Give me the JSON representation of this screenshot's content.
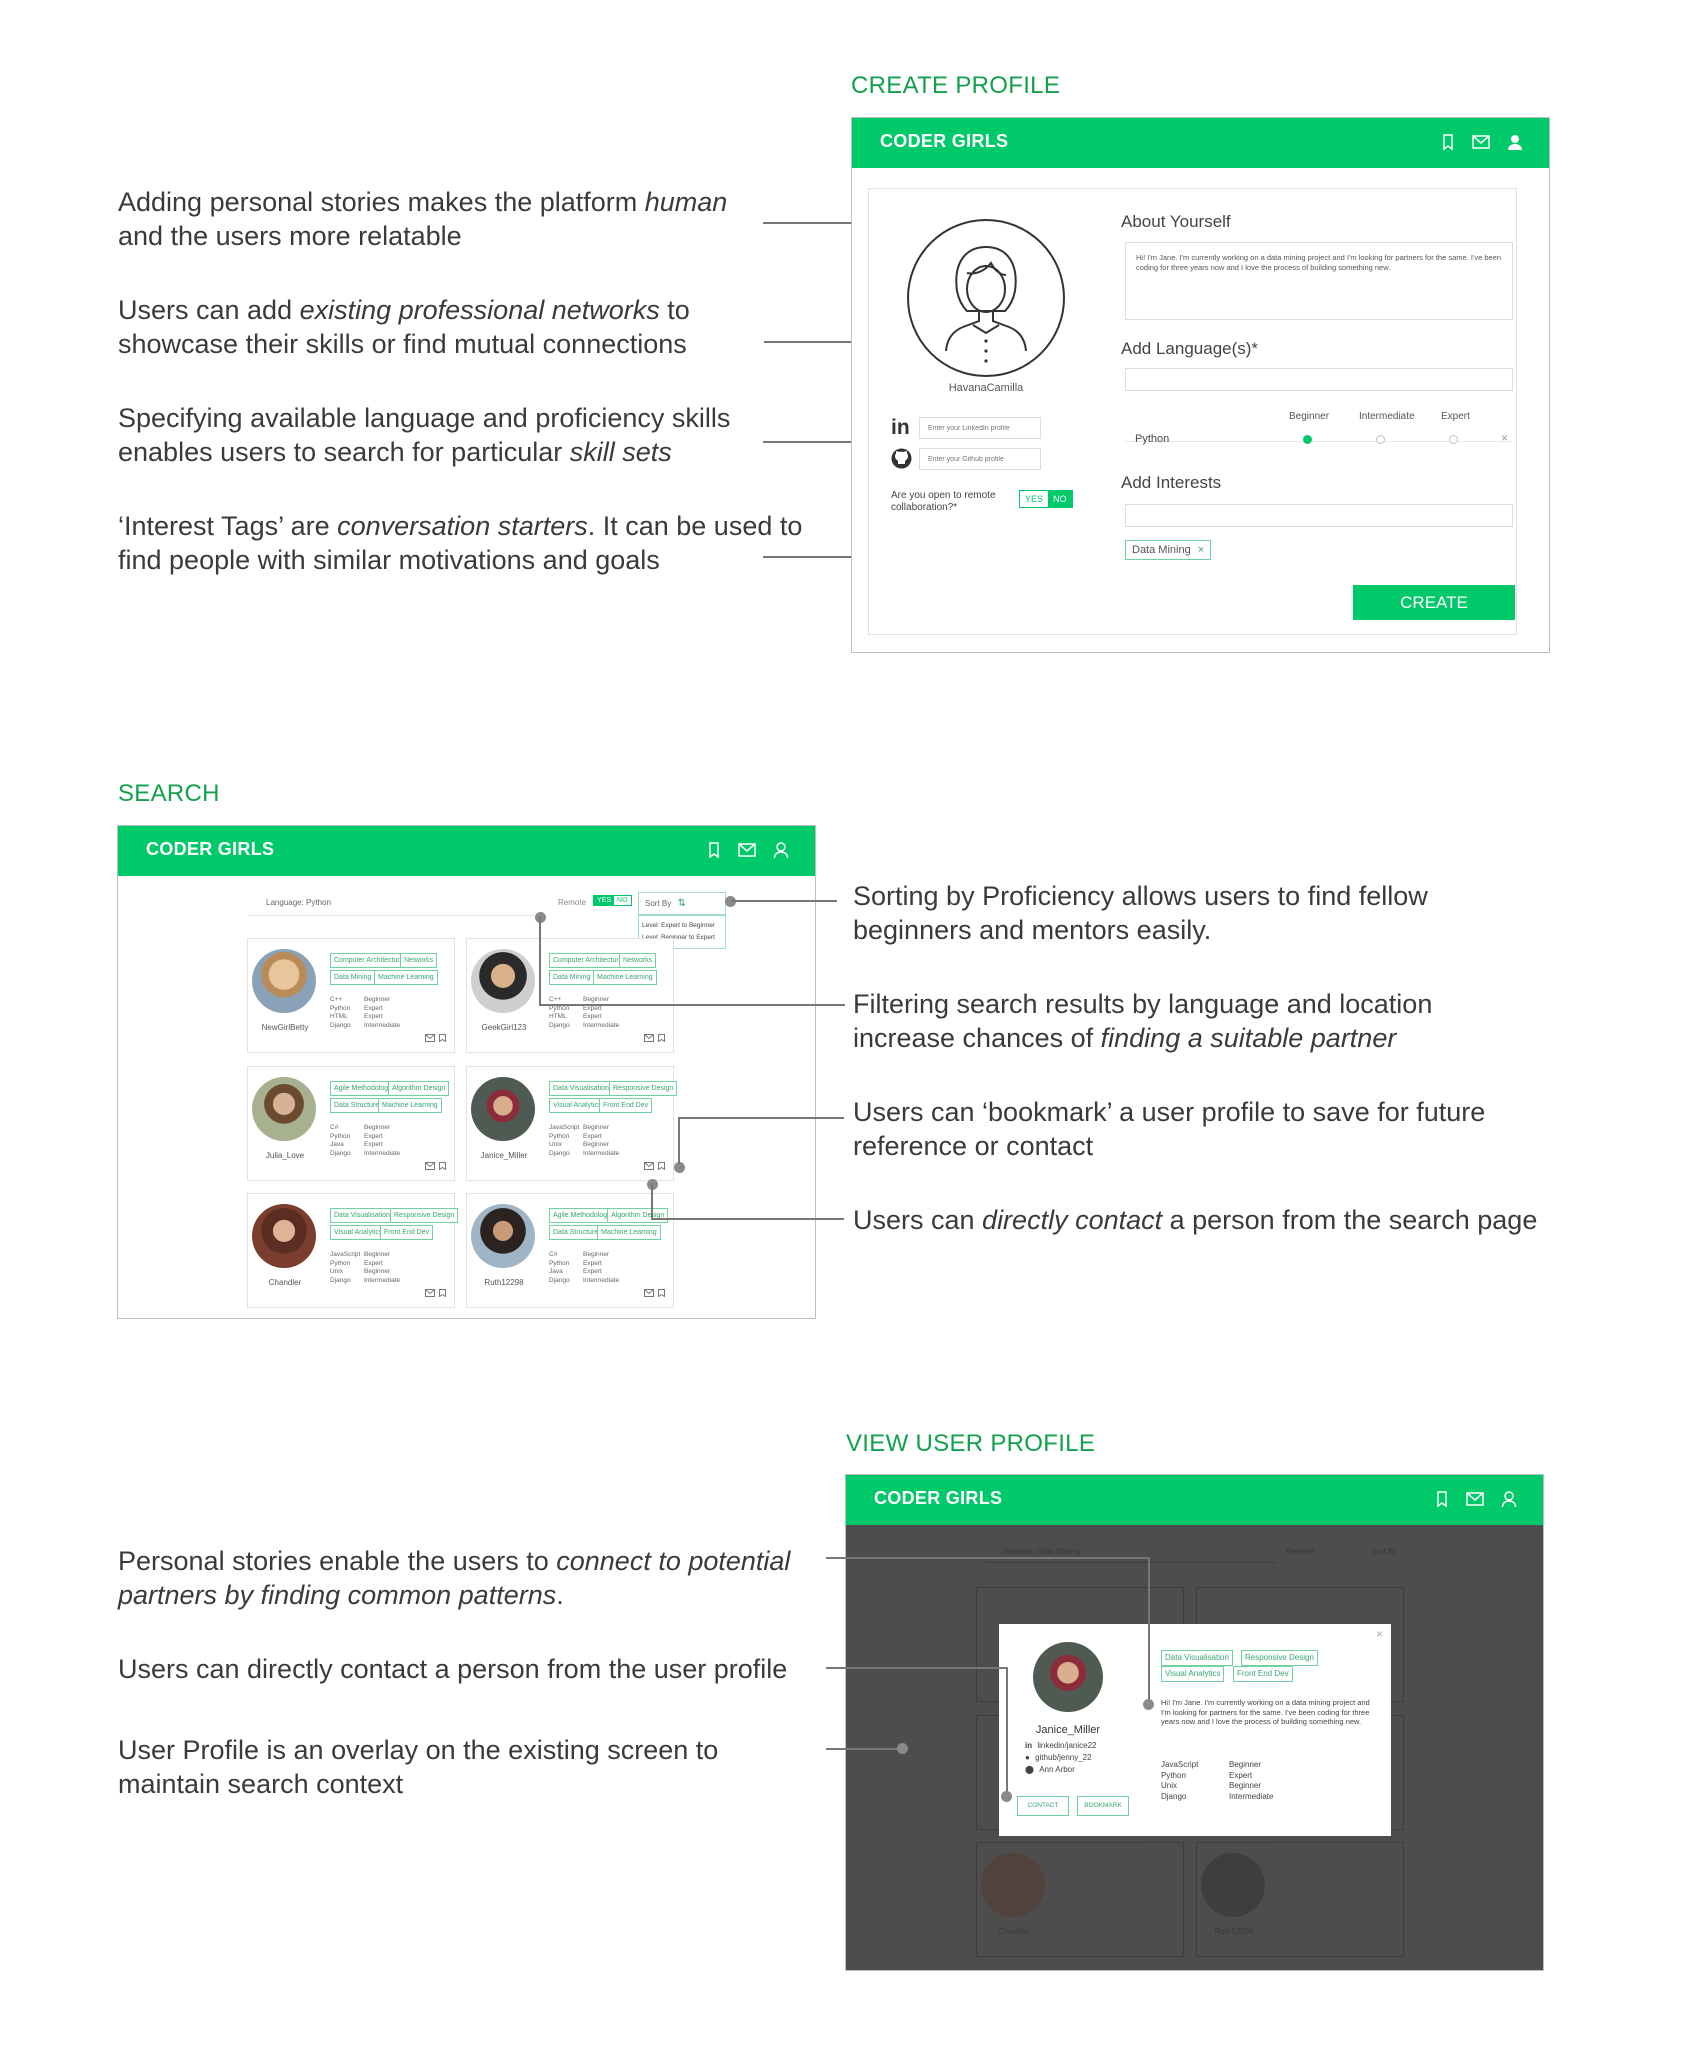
{
  "sections": {
    "create_title": "CREATE PROFILE",
    "search_title": "SEARCH",
    "view_title": "VIEW USER PROFILE"
  },
  "brand": "CODER GIRLS",
  "create": {
    "username": "HavanaCamilla",
    "about_label": "About Yourself",
    "about_text": "Hi! I'm Jane. I'm currently working on a data mining project and I'm looking for partners for the same. I've been coding for three years now and I love the process of building something new.",
    "language_label": "Add Language(s)*",
    "levels": [
      "Beginner",
      "Intermediate",
      "Expert"
    ],
    "language_row": "Python",
    "linkedin_placeholder": "Enter your LinkedIn profile",
    "github_placeholder": "Enter your Github profile",
    "remote_question": "Are you open to remote collaboration?*",
    "yes": "YES",
    "no": "NO",
    "interests_label": "Add Interests",
    "interest_tag": "Data Mining",
    "create_button": "CREATE"
  },
  "search": {
    "query": "Language: Python",
    "remote_label": "Remote",
    "sort_label": "Sort By",
    "sort_options": [
      "Level: Expert to Beginner",
      "Level: Beginner to Expert"
    ],
    "cards": [
      {
        "name": "NewGirlBetty",
        "tags": [
          "Computer Architecture",
          "Networks",
          "Data Mining",
          "Machine Learning"
        ],
        "skills": [
          [
            "C++",
            "Beginner"
          ],
          [
            "Python",
            "Expert"
          ],
          [
            "HTML",
            "Expert"
          ],
          [
            "Django",
            "Intermediate"
          ]
        ]
      },
      {
        "name": "GeekGirl123",
        "tags": [
          "Computer Architecture",
          "Networks",
          "Data Mining",
          "Machine Learning"
        ],
        "skills": [
          [
            "C++",
            "Beginner"
          ],
          [
            "Python",
            "Expert"
          ],
          [
            "HTML",
            "Expert"
          ],
          [
            "Django",
            "Intermediate"
          ]
        ]
      },
      {
        "name": "Julia_Love",
        "tags": [
          "Agile Methodology",
          "Algorithm Design",
          "Data Structure",
          "Machine Learning"
        ],
        "skills": [
          [
            "C#",
            "Beginner"
          ],
          [
            "Python",
            "Expert"
          ],
          [
            "Java",
            "Expert"
          ],
          [
            "Django",
            "Intermediate"
          ]
        ]
      },
      {
        "name": "Janice_Miller",
        "tags": [
          "Data Visualisation",
          "Responsive Design",
          "Visual Analytics",
          "Front End Dev"
        ],
        "skills": [
          [
            "JavaScript",
            "Beginner"
          ],
          [
            "Python",
            "Expert"
          ],
          [
            "Unix",
            "Beginner"
          ],
          [
            "Django",
            "Intermediate"
          ]
        ]
      },
      {
        "name": "Chandler",
        "tags": [
          "Data Visualisation",
          "Responsive Design",
          "Visual Analytics",
          "Front End Dev"
        ],
        "skills": [
          [
            "JavaScript",
            "Beginner"
          ],
          [
            "Python",
            "Expert"
          ],
          [
            "Unix",
            "Beginner"
          ],
          [
            "Django",
            "Intermediate"
          ]
        ]
      },
      {
        "name": "Ruth12298",
        "tags": [
          "Agile Methodology",
          "Algorithm Design",
          "Data Structure",
          "Machine Learning"
        ],
        "skills": [
          [
            "C#",
            "Beginner"
          ],
          [
            "Python",
            "Expert"
          ],
          [
            "Java",
            "Expert"
          ],
          [
            "Django",
            "Intermediate"
          ]
        ]
      }
    ]
  },
  "view": {
    "bg_query": "Interests: Data Mining",
    "bg_remote": "Remote",
    "bg_sort": "Sort By",
    "bg_names": [
      "Chandler",
      "Ruth12298"
    ],
    "profile": {
      "name": "Janice_Miller",
      "linkedin": "linkedin/janice22",
      "github": "github/jenny_22",
      "location": "Ann Arbor",
      "contact": "CONTACT",
      "bookmark": "BOOKMARK",
      "tags": [
        "Data Visualisation",
        "Responsive Design",
        "Visual Analytics",
        "Front End Dev"
      ],
      "about": "Hi! I'm Jane. I'm currently working on a data mining project and I'm looking for partners for the same. I've been coding for three years now and I love the process of building something new.",
      "skills": [
        [
          "JavaScript",
          "Beginner"
        ],
        [
          "Python",
          "Expert"
        ],
        [
          "Unix",
          "Beginner"
        ],
        [
          "Django",
          "Intermediate"
        ]
      ]
    }
  },
  "notes": {
    "n1a": "Adding personal stories makes the platform ",
    "n1b": "human",
    "n1c": "and the users more relatable",
    "n2a": "Users can add ",
    "n2b": "existing professional networks",
    "n2c": " to",
    "n2d": "showcase their skills or find mutual connections",
    "n3a": "Specifying available language and proficiency skills",
    "n3b": "enables users to search for particular ",
    "n3c": "skill sets",
    "n4a": "‘Interest Tags’ are ",
    "n4b": "conversation starters",
    "n4c": ". It can be used to",
    "n4d": "find people with similar motivations and goals",
    "s1a": "Sorting by Proficiency allows users to find fellow",
    "s1b": "beginners and mentors easily.",
    "s2a": "Filtering search results by language and location",
    "s2b": "increase chances of ",
    "s2c": "finding a suitable partner",
    "s3a": "Users can ‘bookmark’ a user profile to save for future",
    "s3b": "reference or contact",
    "s4a": "Users can ",
    "s4b": "directly contact",
    "s4c": " a person from the search page",
    "v1a": "Personal stories enable the users to ",
    "v1b": "connect to potential",
    "v1c": "partners by finding common patterns",
    "v1d": ".",
    "v2": "Users can directly contact a person from the user profile",
    "v3a": "User Profile is an overlay on the existing screen to",
    "v3b": "maintain search context"
  },
  "colors": {
    "accent": "#00c96a",
    "section_title": "#12a14b",
    "overlay": "#4d4d4d"
  }
}
